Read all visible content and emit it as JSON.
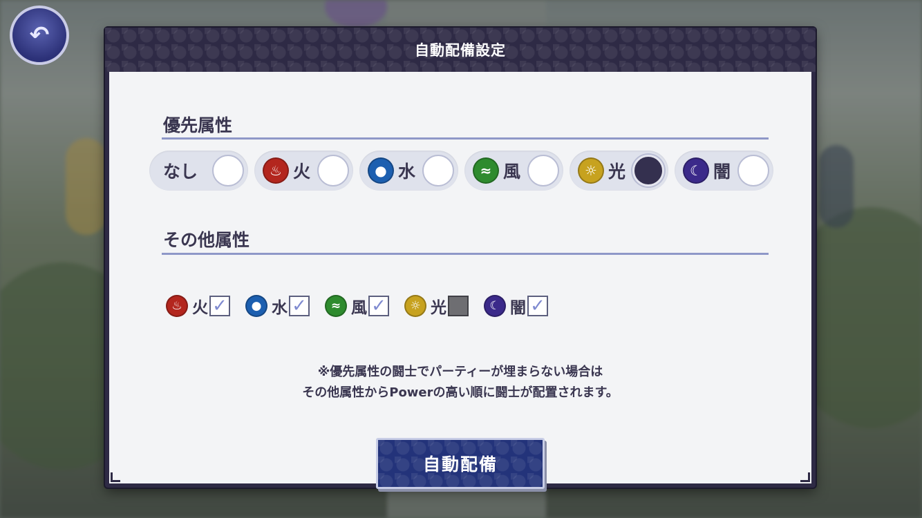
{
  "modal": {
    "title": "自動配備設定",
    "priority": {
      "heading": "優先属性",
      "options": [
        {
          "label": "なし",
          "icon": null,
          "selected": false
        },
        {
          "label": "火",
          "icon": "fire-icon",
          "color": "#b3261e",
          "selected": false
        },
        {
          "label": "水",
          "icon": "water-drop-icon",
          "color": "#1c5fb0",
          "selected": false
        },
        {
          "label": "風",
          "icon": "wind-icon",
          "color": "#2e8b2e",
          "selected": false
        },
        {
          "label": "光",
          "icon": "sun-icon",
          "color": "#c7a21f",
          "selected": true
        },
        {
          "label": "闇",
          "icon": "moon-icon",
          "color": "#3b2a8a",
          "selected": false
        }
      ]
    },
    "other": {
      "heading": "その他属性",
      "options": [
        {
          "label": "火",
          "icon": "fire-icon",
          "color": "#b3261e",
          "checked": true
        },
        {
          "label": "水",
          "icon": "water-drop-icon",
          "color": "#1c5fb0",
          "checked": true
        },
        {
          "label": "風",
          "icon": "wind-icon",
          "color": "#2e8b2e",
          "checked": true
        },
        {
          "label": "光",
          "icon": "sun-icon",
          "color": "#c7a21f",
          "checked": false
        },
        {
          "label": "闇",
          "icon": "moon-icon",
          "color": "#3b2a8a",
          "checked": true
        }
      ],
      "check_mark": "✓"
    },
    "note_line1": "※優先属性の闘士でパーティーが埋まらない場合は",
    "note_line2": "その他属性からPowerの高い順に闘士が配置されます。",
    "button_label": "自動配備"
  },
  "colors": {
    "header_bg": "#2e2a45",
    "button_bg": "#23337a",
    "rule": "#8e97c8",
    "text": "#3a3650"
  }
}
